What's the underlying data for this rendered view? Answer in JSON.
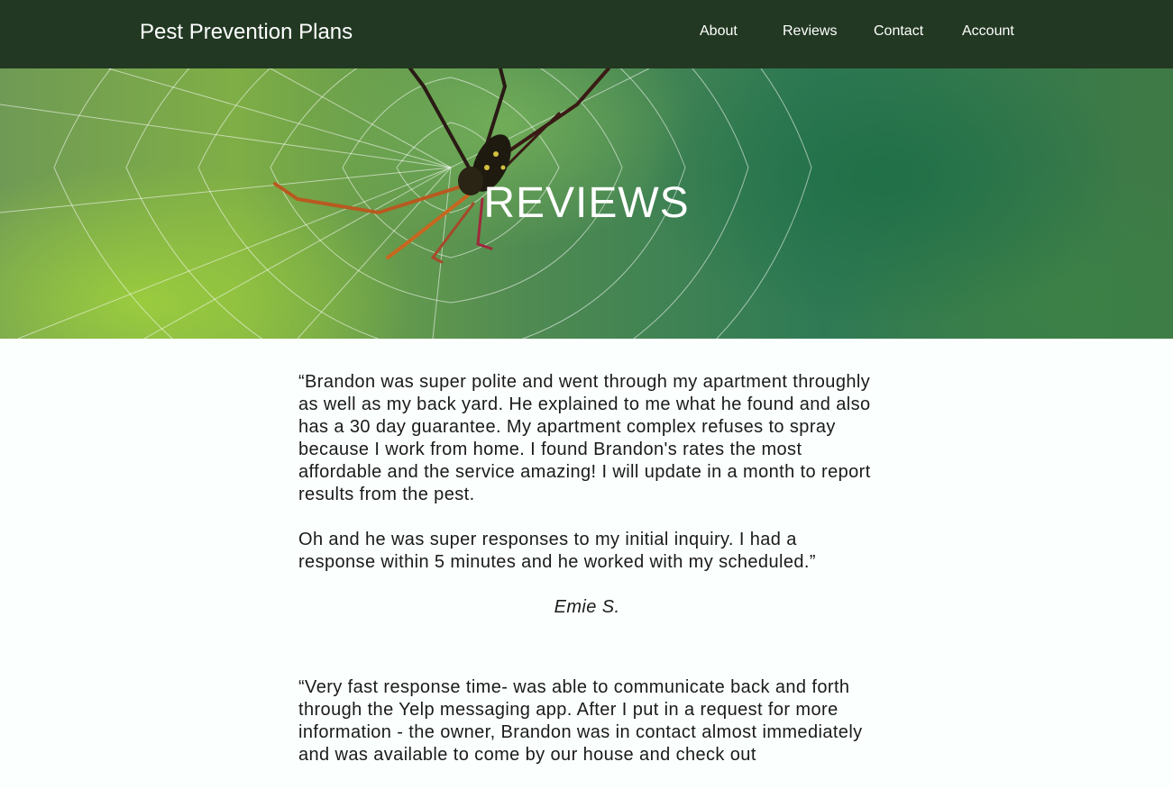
{
  "header": {
    "brand": "Pest Prevention Plans",
    "nav": [
      "About",
      "Reviews",
      "Contact",
      "Account"
    ]
  },
  "hero": {
    "title": "REVIEWS"
  },
  "reviews": [
    {
      "paragraphs": [
        "“Brandon was super polite and went through my apartment throughly as well as my back yard. He explained to me what he found and also has a 30 day guarantee. My apartment complex refuses to spray because I work from home. I found Brandon's rates the most affordable and the service amazing! I will update in a month to report results from the pest.",
        "Oh and he was super responses to my initial inquiry. I had a response within 5 minutes and he worked with my scheduled.”"
      ],
      "author": "Emie S."
    },
    {
      "paragraphs": [
        "“Very fast response time- was able to communicate back and forth through the Yelp messaging app. After I put in a request for more information - the owner, Brandon was in contact almost immediately and was available to come by our house and check out"
      ]
    }
  ],
  "colors": {
    "nav_bg": "#223822",
    "page_bg": "#fbfffd",
    "text": "#1a1a1a"
  }
}
